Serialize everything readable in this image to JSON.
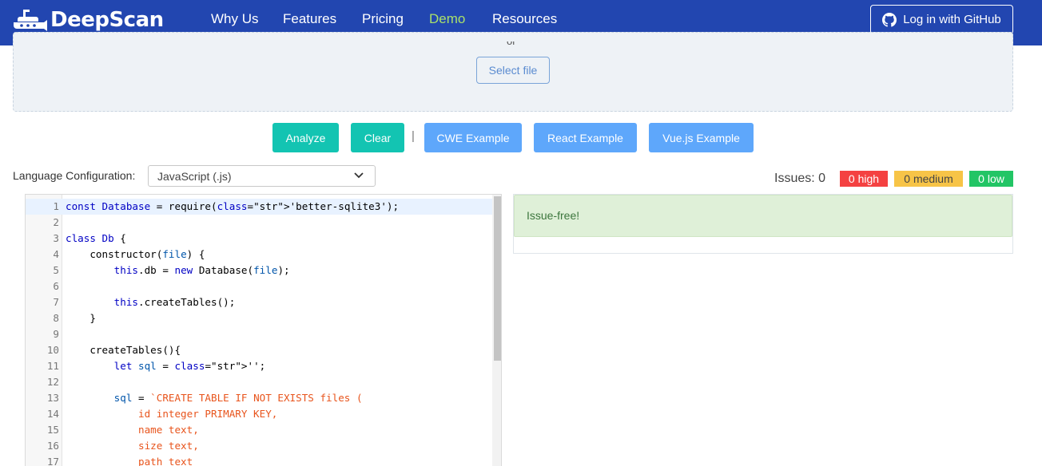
{
  "brand": {
    "name": "DeepScan"
  },
  "nav": {
    "items": [
      {
        "label": "Why Us",
        "active": false
      },
      {
        "label": "Features",
        "active": false
      },
      {
        "label": "Pricing",
        "active": false
      },
      {
        "label": "Demo",
        "active": true
      },
      {
        "label": "Resources",
        "active": false
      }
    ],
    "login_label": "Log in with GitHub"
  },
  "upload": {
    "or_text": "or",
    "select_file_label": "Select file"
  },
  "actions": {
    "analyze": "Analyze",
    "clear": "Clear",
    "separator": "|",
    "cwe_example": "CWE Example",
    "react_example": "React Example",
    "vue_example": "Vue.js Example"
  },
  "language": {
    "label": "Language Configuration:",
    "selected": "JavaScript (.js)"
  },
  "issues": {
    "label": "Issues: 0",
    "high": "0 high",
    "medium": "0 medium",
    "low": "0 low"
  },
  "colors": {
    "nav_bg": "#2246b0",
    "demo_active": "#a9e06a",
    "teal": "#13c4b2",
    "blue": "#5ea7fb",
    "high": "#f44141",
    "medium": "#f7c447",
    "low": "#22c565",
    "success_bg": "#dff0d8"
  },
  "result": {
    "message": "Issue-free!"
  },
  "code": {
    "lines": [
      {
        "num": "1",
        "text": "const Database = require('better-sqlite3');"
      },
      {
        "num": "2",
        "text": ""
      },
      {
        "num": "3",
        "text": "class Db {"
      },
      {
        "num": "4",
        "text": "    constructor(file) {"
      },
      {
        "num": "5",
        "text": "        this.db = new Database(file);"
      },
      {
        "num": "6",
        "text": ""
      },
      {
        "num": "7",
        "text": "        this.createTables();"
      },
      {
        "num": "8",
        "text": "    }"
      },
      {
        "num": "9",
        "text": ""
      },
      {
        "num": "10",
        "text": "    createTables(){"
      },
      {
        "num": "11",
        "text": "        let sql = '';"
      },
      {
        "num": "12",
        "text": ""
      },
      {
        "num": "13",
        "text": "        sql = `CREATE TABLE IF NOT EXISTS files ("
      },
      {
        "num": "14",
        "text": "            id integer PRIMARY KEY,"
      },
      {
        "num": "15",
        "text": "            name text,"
      },
      {
        "num": "16",
        "text": "            size text,"
      },
      {
        "num": "17",
        "text": "            path text"
      }
    ]
  }
}
